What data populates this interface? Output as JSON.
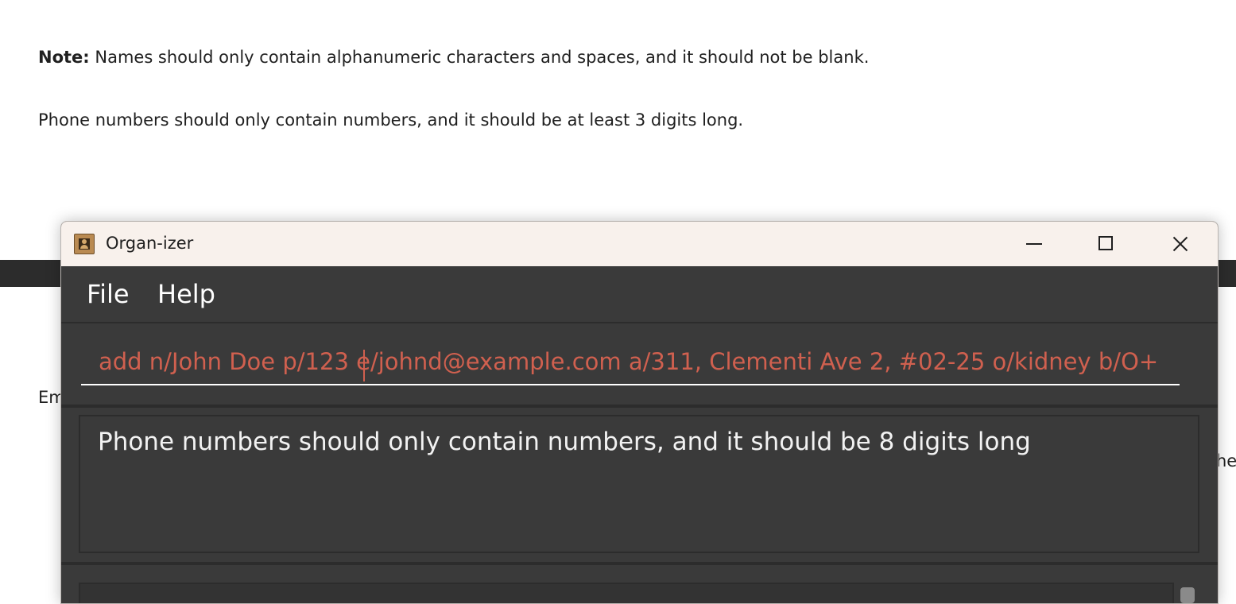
{
  "doc": {
    "note_label": "Note:",
    "note_text": " Names should only contain alphanumeric characters and spaces, and it should not be blank.",
    "phone_text": "Phone numbers should only contain numbers, and it should be at least 3 digits long.",
    "fragment_left": "Em",
    "fragment_right": "he"
  },
  "window": {
    "title": "Organ-izer",
    "menu": [
      "File",
      "Help"
    ],
    "command_value": "add n/John Doe p/123 e/johnd@example.com a/311, Clementi Ave 2, #02-25 o/kidney b/O+ r,",
    "result_message": "Phone numbers should only contain numbers, and it should be 8 digits long",
    "colors": {
      "error_text": "#d0604f",
      "panel_bg": "#3a3a3a",
      "titlebar_bg": "#f8f1ec"
    }
  }
}
